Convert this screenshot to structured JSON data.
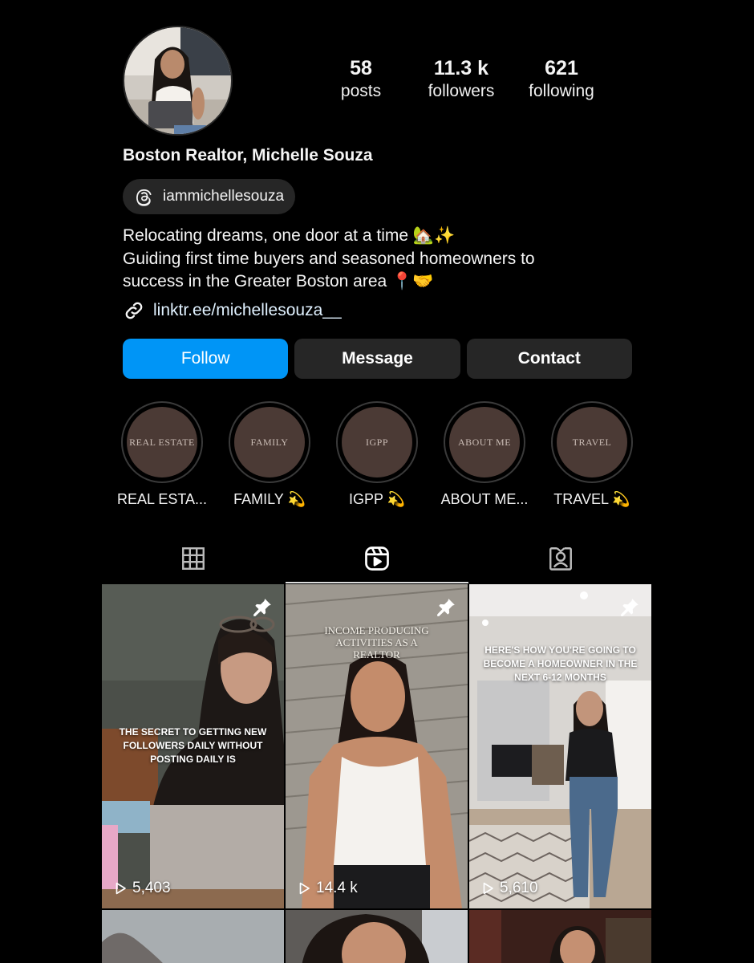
{
  "profile": {
    "avatar": "profile-photo",
    "display_name": "Boston Realtor, Michelle Souza",
    "threads_handle": "iammichellesouza",
    "bio_lines": [
      "Relocating dreams, one door at a time 🏡✨",
      "Guiding first time buyers and seasoned homeowners to",
      "success in the Greater Boston area 📍🤝"
    ],
    "link": "linktr.ee/michellesouza__"
  },
  "stats": [
    {
      "value": "58",
      "label": "posts"
    },
    {
      "value": "11.3 k",
      "label": "followers"
    },
    {
      "value": "621",
      "label": "following"
    }
  ],
  "actions": {
    "follow": "Follow",
    "message": "Message",
    "contact": "Contact"
  },
  "highlights": [
    {
      "cover": "REAL ESTATE",
      "caption": "REAL ESTA..."
    },
    {
      "cover": "FAMILY",
      "caption": "FAMILY 💫"
    },
    {
      "cover": "IGPP",
      "caption": "IGPP 💫"
    },
    {
      "cover": "ABOUT ME",
      "caption": "ABOUT ME..."
    },
    {
      "cover": "TRAVEL",
      "caption": "TRAVEL 💫"
    }
  ],
  "tabs": [
    {
      "icon": "grid-icon",
      "active": false
    },
    {
      "icon": "reels-icon",
      "active": true
    },
    {
      "icon": "tagged-icon",
      "active": false
    }
  ],
  "reels": [
    {
      "overlay": "THE SECRET TO GETTING NEW FOLLOWERS DAILY WITHOUT POSTING DAILY IS",
      "views": "5,403",
      "pinned": true
    },
    {
      "overlay": "INCOME PRODUCING ACTIVITIES AS A REALTOR",
      "views": "14.4 k",
      "pinned": true
    },
    {
      "overlay": "HERE'S HOW YOU'RE GOING TO BECOME A HOMEOWNER IN THE NEXT 6-12 MONTHS",
      "views": "5,610",
      "pinned": true
    }
  ],
  "colors": {
    "background": "#000000",
    "follow_button": "#0095f6",
    "secondary_button": "#262626",
    "highlight_cover": "#4b3a35"
  }
}
